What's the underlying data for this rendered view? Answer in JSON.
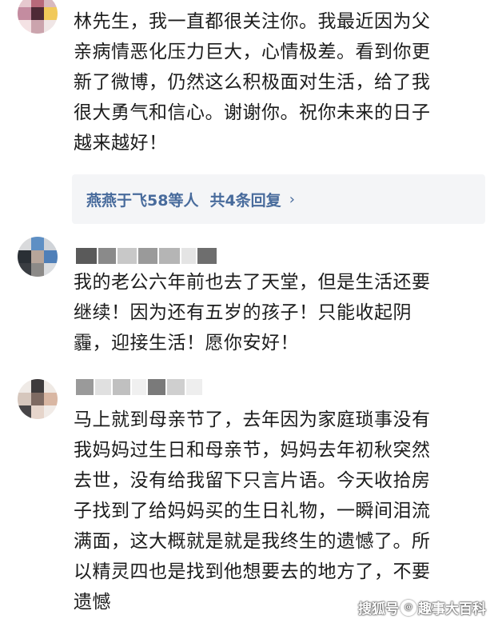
{
  "comments": [
    {
      "lines": [
        "林先生，我一直都很关注你。我最近因为父",
        "亲病情恶化压力巨大，心情极差。看到你更",
        "新了微博，仍然这么积极面对生活，给了我",
        "很大勇气和信心。谢谢你。祝你未来的日子",
        "越来越好！"
      ],
      "reply": {
        "users": "燕燕于飞58等人",
        "count": "共4条回复",
        "chevron": "›"
      }
    },
    {
      "lines": [
        "我的老公六年前也去了天堂，但是生活还要",
        "继续！因为还有五岁的孩子！只能收起阴",
        "霾，迎接生活！愿你安好！"
      ]
    },
    {
      "lines": [
        "马上就到母亲节了，去年因为家庭琐事没有",
        "我妈妈过生日和母亲节，妈妈去年初秋突然",
        "去世，没有给我留下只言片语。今天收拾房",
        "子找到了给妈妈买的生日礼物，一瞬间泪流",
        "满面，这大概就是就是我终生的遗憾了。所",
        "以精灵四也是找到他想要去的地方了，不要",
        "遗憾"
      ]
    }
  ],
  "watermark": {
    "brand": "搜狐号",
    "at": "@",
    "account": "趣事大百科"
  },
  "colors": {
    "link": "#486b9c",
    "reply_bg": "#f4f5f7",
    "text": "#1c1c1c"
  }
}
